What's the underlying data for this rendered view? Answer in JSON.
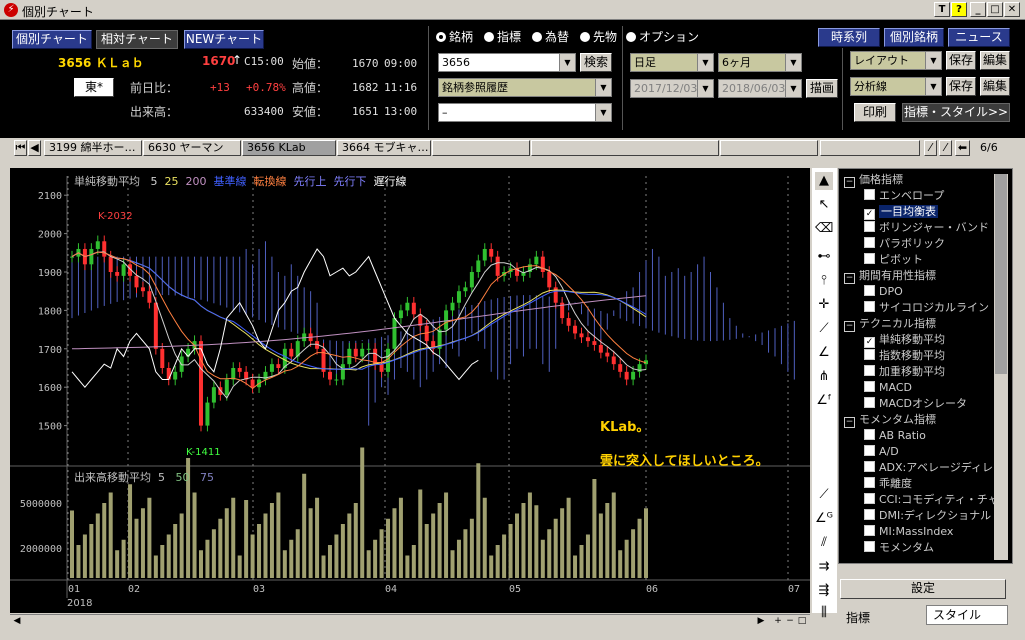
{
  "window": {
    "title": "個別チャート",
    "icon": "app-icon",
    "buttons": [
      "T",
      "?",
      "_",
      "□",
      "✕"
    ]
  },
  "view_buttons": [
    "個別チャート",
    "相対チャート",
    "NEWチャート"
  ],
  "stock": {
    "code_name": "3656 ＫＬａｂ",
    "price": "1670",
    "arrow": "↑",
    "time": "C15:00",
    "market": "東*",
    "change_label": "前日比：",
    "change": "+13",
    "change_pct": "+0.78%",
    "volume_label": "出来高：",
    "volume": "633400"
  },
  "ohlc": [
    {
      "label": "始値：",
      "value": "1670",
      "time": "09:00"
    },
    {
      "label": "高値：",
      "value": "1682",
      "time": "11:16"
    },
    {
      "label": "安値：",
      "value": "1651",
      "time": "13:00"
    }
  ],
  "radios": [
    {
      "label": "銘柄",
      "on": true
    },
    {
      "label": "指標",
      "on": false
    },
    {
      "label": "為替",
      "on": false
    },
    {
      "label": "先物",
      "on": false
    },
    {
      "label": "オプション",
      "on": false
    }
  ],
  "search": {
    "code": "3656",
    "button": "検索",
    "history": "銘柄参照履歴",
    "third": "–"
  },
  "period": {
    "interval": "日足",
    "range": "6ヶ月",
    "from": "2017/12/03",
    "to": "2018/06/03",
    "draw": "描画"
  },
  "right_buttons": {
    "timeseries": "時系列",
    "individual": "個別銘柄",
    "news": "ニュース",
    "layout": "レイアウト",
    "save1": "保存",
    "edit1": "編集",
    "analysis": "分析線",
    "save2": "保存",
    "edit2": "編集",
    "print": "印刷",
    "indicator_style": "指標・スタイル>>"
  },
  "tabs": [
    "3199 綿半ホー…",
    "6630 ヤーマン",
    "3656 KLab",
    "3664 モブキャ…"
  ],
  "tab_count": "6/6",
  "chart": {
    "legend_title": "単純移動平均",
    "legend": [
      {
        "t": "5",
        "c": "#d0d0d0"
      },
      {
        "t": "25",
        "c": "#e8e060"
      },
      {
        "t": "200",
        "c": "#c090c0"
      },
      {
        "t": "基準線",
        "c": "#4060ff"
      },
      {
        "t": "転換線",
        "c": "#ff8040"
      },
      {
        "t": "先行上",
        "c": "#8080ff"
      },
      {
        "t": "先行下",
        "c": "#8080ff"
      },
      {
        "t": "遅行線",
        "c": "#ffffff"
      }
    ],
    "y_ticks": [
      "2100",
      "2000",
      "1900",
      "1800",
      "1700",
      "1600",
      "1500"
    ],
    "high_label": "K-2032",
    "low_label": "K-1411",
    "annotation1": "KLab。",
    "annotation2": "雲に突入してほしいところ。",
    "vol_legend_title": "出来高移動平均",
    "vol_legend": [
      "5",
      "50",
      "75"
    ],
    "vol_ticks": [
      "5000000",
      "2000000"
    ],
    "x_ticks": [
      "01",
      "02",
      "03",
      "04",
      "05",
      "06",
      "07"
    ],
    "year": "2018"
  },
  "chart_data": {
    "type": "candlestick",
    "title": "",
    "ylim": [
      1400,
      2150
    ],
    "x": [
      "01",
      "02",
      "03",
      "04",
      "05",
      "06"
    ],
    "candles_close": [
      1940,
      1960,
      1920,
      1960,
      1980,
      1940,
      1900,
      1890,
      1920,
      1890,
      1860,
      1850,
      1820,
      1700,
      1650,
      1620,
      1640,
      1680,
      1700,
      1720,
      1500,
      1560,
      1600,
      1580,
      1620,
      1650,
      1640,
      1620,
      1600,
      1620,
      1640,
      1660,
      1650,
      1700,
      1680,
      1720,
      1740,
      1720,
      1700,
      1640,
      1620,
      1620,
      1660,
      1700,
      1680,
      1700,
      1700,
      1660,
      1640,
      1700,
      1780,
      1800,
      1820,
      1790,
      1760,
      1720,
      1700,
      1750,
      1800,
      1820,
      1850,
      1860,
      1900,
      1930,
      1960,
      1940,
      1890,
      1900,
      1910,
      1890,
      1900,
      1920,
      1940,
      1900,
      1860,
      1820,
      1780,
      1760,
      1740,
      1730,
      1720,
      1710,
      1690,
      1680,
      1660,
      1640,
      1620,
      1640,
      1660,
      1670
    ],
    "volume_ylim": [
      0,
      7000000
    ]
  },
  "indicators": [
    {
      "t": "価格指標",
      "g": true,
      "c": "−"
    },
    {
      "t": "エンベロープ",
      "c": ""
    },
    {
      "t": "一目均衡表",
      "c": "✓",
      "s": true
    },
    {
      "t": "ボリンジャー・バンド",
      "c": ""
    },
    {
      "t": "パラボリック",
      "c": ""
    },
    {
      "t": "ピボット",
      "c": ""
    },
    {
      "t": "期間有用性指標",
      "g": true,
      "c": "−"
    },
    {
      "t": "DPO",
      "c": ""
    },
    {
      "t": "サイコロジカルライン",
      "c": ""
    },
    {
      "t": "テクニカル指標",
      "g": true,
      "c": "−"
    },
    {
      "t": "単純移動平均",
      "c": "✓"
    },
    {
      "t": "指数移動平均",
      "c": ""
    },
    {
      "t": "加重移動平均",
      "c": ""
    },
    {
      "t": "MACD",
      "c": ""
    },
    {
      "t": "MACDオシレータ",
      "c": ""
    },
    {
      "t": "モメンタム指標",
      "g": true,
      "c": "−"
    },
    {
      "t": "AB Ratio",
      "c": ""
    },
    {
      "t": "A/D",
      "c": ""
    },
    {
      "t": "ADX:アベレージディレ",
      "c": ""
    },
    {
      "t": "乖離度",
      "c": ""
    },
    {
      "t": "CCI:コモディティ・チャ",
      "c": ""
    },
    {
      "t": "DMI:ディレクショナル",
      "c": ""
    },
    {
      "t": "MI:MassIndex",
      "c": ""
    },
    {
      "t": "モメンタム",
      "c": ""
    }
  ],
  "settings": "設定",
  "bottom_tabs": [
    "指標",
    "スタイル"
  ]
}
